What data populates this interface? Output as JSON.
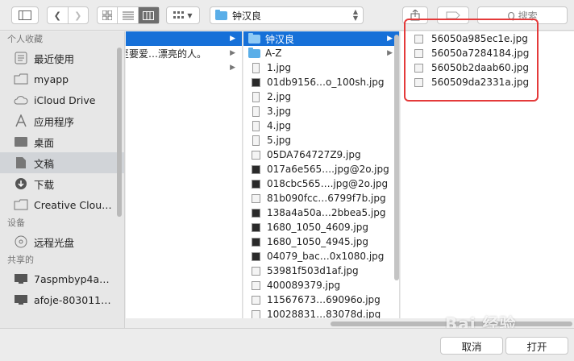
{
  "toolbar": {
    "path_label": "钟汉良",
    "search_placeholder": "Q 搜索"
  },
  "sidebar": {
    "sections": [
      {
        "header": "个人收藏",
        "items": [
          {
            "label": "最近使用",
            "icon": "recent-icon"
          },
          {
            "label": "myapp",
            "icon": "folder-icon"
          },
          {
            "label": "iCloud Drive",
            "icon": "cloud-icon"
          },
          {
            "label": "应用程序",
            "icon": "applications-icon"
          },
          {
            "label": "桌面",
            "icon": "desktop-icon"
          },
          {
            "label": "文稿",
            "icon": "documents-icon",
            "selected": true
          },
          {
            "label": "下载",
            "icon": "download-icon"
          },
          {
            "label": "Creative Clou…",
            "icon": "folder-icon"
          }
        ]
      },
      {
        "header": "设备",
        "items": [
          {
            "label": "远程光盘",
            "icon": "disc-icon"
          }
        ]
      },
      {
        "header": "共享的",
        "items": [
          {
            "label": "7aspmbyp4a…",
            "icon": "computer-icon"
          },
          {
            "label": "afoje-803011…",
            "icon": "computer-icon"
          }
        ]
      }
    ]
  },
  "column1": [
    {
      "label": "",
      "selected": true
    },
    {
      "label": "至要爱…漂亮的人。"
    }
  ],
  "column2": [
    {
      "label": "钟汉良",
      "type": "folder",
      "selected": true
    },
    {
      "label": "A-Z",
      "type": "folder"
    },
    {
      "label": "1.jpg",
      "type": "tall"
    },
    {
      "label": "01db9156…o_100sh.jpg",
      "type": "dark"
    },
    {
      "label": "2.jpg",
      "type": "tall"
    },
    {
      "label": "3.jpg",
      "type": "tall"
    },
    {
      "label": "4.jpg",
      "type": "tall"
    },
    {
      "label": "5.jpg",
      "type": "tall"
    },
    {
      "label": "05DA764727Z9.jpg",
      "type": "light"
    },
    {
      "label": "017a6e565….jpg@2o.jpg",
      "type": "dark"
    },
    {
      "label": "018cbc565….jpg@2o.jpg",
      "type": "dark"
    },
    {
      "label": "81b090fcc…6799f7b.jpg",
      "type": "light"
    },
    {
      "label": "138a4a50a…2bbea5.jpg",
      "type": "dark"
    },
    {
      "label": "1680_1050_4609.jpg",
      "type": "dark"
    },
    {
      "label": "1680_1050_4945.jpg",
      "type": "dark"
    },
    {
      "label": "04079_bac…0x1080.jpg",
      "type": "dark"
    },
    {
      "label": "53981f503d1af.jpg",
      "type": "light"
    },
    {
      "label": "400089379.jpg",
      "type": "light"
    },
    {
      "label": "11567673…69096o.jpg",
      "type": "light"
    },
    {
      "label": "10028831…83078d.jpg",
      "type": "light"
    }
  ],
  "column3": [
    {
      "label": "56050a985ec1e.jpg"
    },
    {
      "label": "56050a7284184.jpg"
    },
    {
      "label": "56050b2daab60.jpg"
    },
    {
      "label": "560509da2331a.jpg"
    }
  ],
  "buttons": {
    "cancel": "取消",
    "open": "打开"
  },
  "watermark": "Bai 经验"
}
